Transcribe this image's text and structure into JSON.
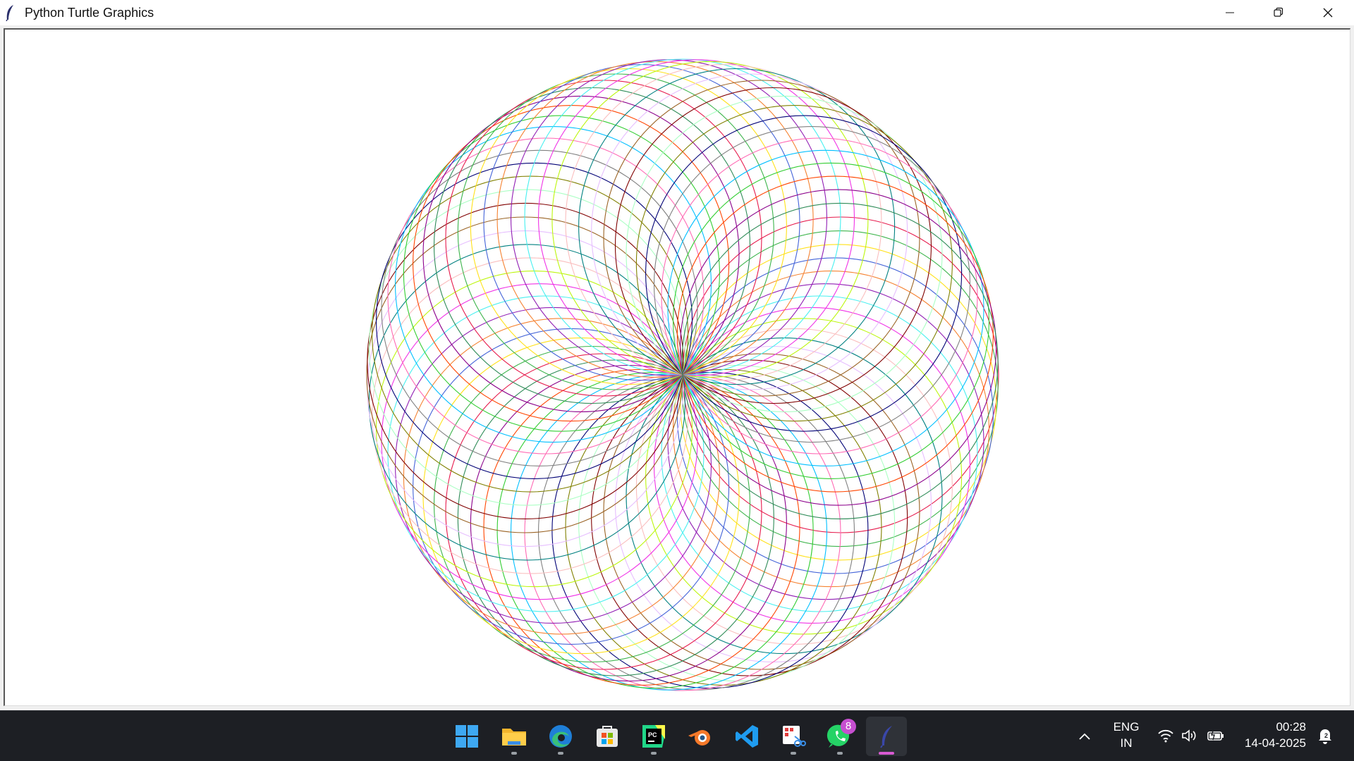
{
  "window": {
    "title": "Python Turtle Graphics",
    "controls": [
      "minimize",
      "maximize",
      "close"
    ]
  },
  "canvas": {
    "description_hidden": "",
    "palette": [
      "#e6194b",
      "#3cb44b",
      "#ffe119",
      "#4363d8",
      "#f58231",
      "#911eb4",
      "#46f0f0",
      "#f032e6",
      "#bcf60c",
      "#fabebe",
      "#008080",
      "#e6beff",
      "#9a6324",
      "#800000",
      "#aaffc3",
      "#808000",
      "#000075",
      "#808080",
      "#ff69b4",
      "#00bfff",
      "#32cd32",
      "#ff4500",
      "#8b008b",
      "#2e8b57"
    ]
  },
  "taskbar": {
    "apps": [
      {
        "name": "start",
        "icon": "windows-logo-icon",
        "running": false
      },
      {
        "name": "file-explorer",
        "icon": "folder-icon",
        "running": true
      },
      {
        "name": "edge",
        "icon": "edge-browser-icon",
        "running": true
      },
      {
        "name": "store",
        "icon": "store-icon",
        "running": false
      },
      {
        "name": "pycharm",
        "icon": "pycharm-icon",
        "running": true
      },
      {
        "name": "blender",
        "icon": "blender-icon",
        "running": false
      },
      {
        "name": "vscode",
        "icon": "vscode-icon",
        "running": false
      },
      {
        "name": "snipping-tool",
        "icon": "snipping-tool-icon",
        "running": true
      },
      {
        "name": "whatsapp",
        "icon": "whatsapp-icon",
        "running": true,
        "badge": "8"
      },
      {
        "name": "python-turtle",
        "icon": "feather-icon",
        "running": true,
        "active": true
      }
    ],
    "tray": {
      "chevron": "chevron-up-icon",
      "language_line1": "ENG",
      "language_line2": "IN",
      "wifi": "wifi-icon",
      "volume": "volume-icon",
      "battery": "battery-icon",
      "time": "00:28",
      "date": "14-04-2025",
      "notifications": "notification-bell-icon",
      "notification_count": "2"
    }
  },
  "colors": {
    "taskbar_bg": "#1d1f24",
    "titlebar_bg": "#ffffff",
    "canvas_bg": "#ffffff",
    "active_indicator": "#d85ad2"
  }
}
